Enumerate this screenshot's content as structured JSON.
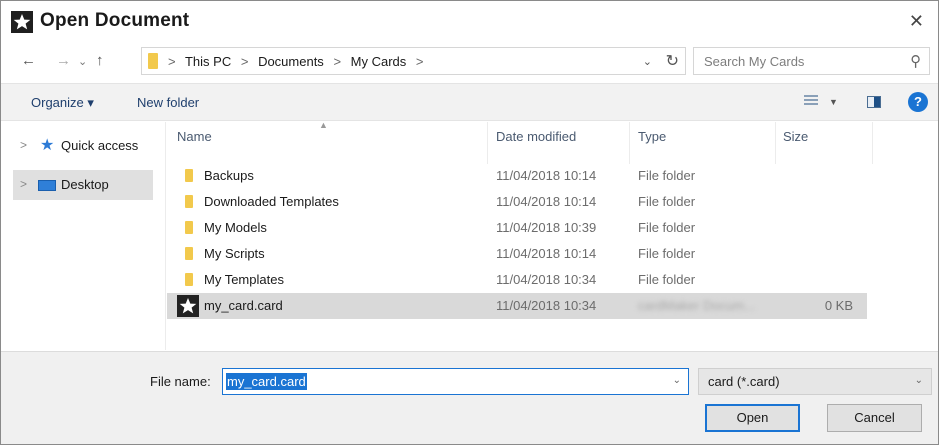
{
  "window": {
    "title": "Open Document",
    "close_glyph": "✕",
    "app_icon": "star-icon"
  },
  "nav": {
    "back_glyph": "←",
    "forward_glyph": "→",
    "recent_glyph": "⌄",
    "up_glyph": "↑"
  },
  "address": {
    "segments": [
      "This PC",
      "Documents",
      "My Cards"
    ],
    "separator": ">",
    "dropdown_glyph": "⌄",
    "refresh_glyph": "↻"
  },
  "search": {
    "placeholder": "Search My Cards",
    "icon": "search-icon"
  },
  "toolbar": {
    "organize_label": "Organize ▾",
    "new_folder_label": "New folder",
    "help_glyph": "?"
  },
  "sidebar": {
    "items": [
      {
        "label": "Quick access",
        "icon": "star-icon"
      },
      {
        "label": "Desktop",
        "icon": "desktop-icon",
        "selected": true
      }
    ]
  },
  "columns": {
    "name": "Name",
    "date": "Date modified",
    "type": "Type",
    "size": "Size"
  },
  "files": [
    {
      "name": "Backups",
      "date": "11/04/2018 10:14",
      "type": "File folder",
      "size": ""
    },
    {
      "name": "Downloaded Templates",
      "date": "11/04/2018 10:14",
      "type": "File folder",
      "size": ""
    },
    {
      "name": "My Models",
      "date": "11/04/2018 10:39",
      "type": "File folder",
      "size": ""
    },
    {
      "name": "My Scripts",
      "date": "11/04/2018 10:14",
      "type": "File folder",
      "size": ""
    },
    {
      "name": "My Templates",
      "date": "11/04/2018 10:34",
      "type": "File folder",
      "size": ""
    },
    {
      "name": "my_card.card",
      "date": "11/04/2018 10:34",
      "type": "cardMaker Docum...",
      "size": "0 KB",
      "selected": true
    }
  ],
  "filename": {
    "label": "File name:",
    "value": "my_card.card"
  },
  "filter": {
    "value": "card (*.card)"
  },
  "buttons": {
    "open_label": "Open",
    "cancel_label": "Cancel"
  },
  "colors": {
    "accent": "#1a74d3",
    "folder": "#f2c94c",
    "selection": "#d9d9d9"
  }
}
